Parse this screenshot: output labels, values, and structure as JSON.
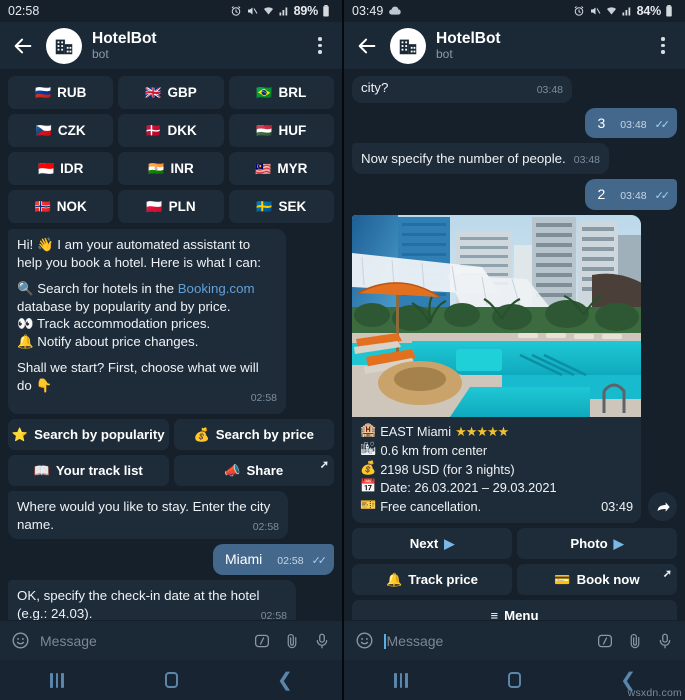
{
  "left": {
    "statusbar": {
      "time": "02:58",
      "battery": "89%",
      "icons": [
        "alarm-icon",
        "mute-icon",
        "wifi-icon",
        "signal-icon",
        "battery-icon"
      ]
    },
    "header": {
      "title": "HotelBot",
      "subtitle": "bot",
      "back_icon": "back-arrow-icon",
      "avatar_icon": "building-icon",
      "menu_icon": "kebab-menu-icon"
    },
    "currency_keyboard": [
      {
        "flag": "🇷🇺",
        "code": "RUB"
      },
      {
        "flag": "🇬🇧",
        "code": "GBP"
      },
      {
        "flag": "🇧🇷",
        "code": "BRL"
      },
      {
        "flag": "🇨🇿",
        "code": "CZK"
      },
      {
        "flag": "🇩🇰",
        "code": "DKK"
      },
      {
        "flag": "🇭🇺",
        "code": "HUF"
      },
      {
        "flag": "🇮🇩",
        "code": "IDR"
      },
      {
        "flag": "🇮🇳",
        "code": "INR"
      },
      {
        "flag": "🇲🇾",
        "code": "MYR"
      },
      {
        "flag": "🇳🇴",
        "code": "NOK"
      },
      {
        "flag": "🇵🇱",
        "code": "PLN"
      },
      {
        "flag": "🇸🇪",
        "code": "SEK"
      }
    ],
    "welcome": {
      "line1": "Hi! 👋 I am your automated assistant to help you book a hotel. Here is what I can:",
      "line2_pre": "🔍 Search for hotels in the ",
      "line2_link": "Booking.com",
      "line2_post": " database by popularity and by price.",
      "line3": "👀 Track accommodation prices.",
      "line4": "🔔 Notify about price changes.",
      "line5": "Shall we start? First, choose what we will do 👇",
      "time": "02:58"
    },
    "action_buttons": [
      {
        "emoji": "⭐",
        "label": "Search by popularity"
      },
      {
        "emoji": "💰",
        "label": "Search by price"
      },
      {
        "emoji": "📖",
        "label": "Your track list"
      },
      {
        "emoji": "📣",
        "label": "Share",
        "corner": "share-arrow-icon"
      }
    ],
    "messages": [
      {
        "from": "bot",
        "text": "Where would you like to stay. Enter the city name.",
        "time": "02:58"
      },
      {
        "from": "user",
        "text": "Miami",
        "time": "02:58",
        "status": "read"
      },
      {
        "from": "bot",
        "text": "OK, specify the check-in date at the hotel (e.g.: 24.03).",
        "time": "02:58"
      }
    ],
    "input": {
      "placeholder": "Message",
      "emoji_icon": "smiley-icon",
      "command_icon": "slash-command-icon",
      "attach_icon": "paperclip-icon",
      "voice_icon": "microphone-icon"
    },
    "nav": {
      "recent_icon": "recent-apps-icon",
      "home_icon": "home-icon",
      "back_icon": "back-icon"
    }
  },
  "right": {
    "statusbar": {
      "time": "03:49",
      "battery": "84%",
      "icons": [
        "cloud-icon",
        "alarm-icon",
        "mute-icon",
        "wifi-icon",
        "signal-icon",
        "battery-icon"
      ]
    },
    "header": {
      "title": "HotelBot",
      "subtitle": "bot",
      "back_icon": "back-arrow-icon",
      "avatar_icon": "building-icon",
      "menu_icon": "kebab-menu-icon"
    },
    "messages": [
      {
        "from": "bot",
        "text": "city?",
        "time": "03:48"
      },
      {
        "from": "user",
        "text": "3",
        "time": "03:48",
        "status": "read"
      },
      {
        "from": "bot",
        "text": "Now specify the number of people.",
        "time": "03:48"
      },
      {
        "from": "user",
        "text": "2",
        "time": "03:48",
        "status": "read"
      }
    ],
    "hotel_card": {
      "photo_alt": "hotel-pool-photo",
      "name_emoji": "🏨",
      "name": "EAST Miami",
      "stars": "★★★★★",
      "distance_emoji": "🏙",
      "distance": "0.6 km from center",
      "price_emoji": "💰",
      "price": "2198 USD (for 3 nights)",
      "date_emoji": "📅",
      "date": "Date: 26.03.2021 – 29.03.2021",
      "cancel_emoji": "🎫",
      "cancellation": "Free cancellation.",
      "time": "03:49",
      "forward_icon": "forward-arrow-icon"
    },
    "action_buttons": [
      {
        "label": "Next",
        "trailing": "▶"
      },
      {
        "label": "Photo",
        "trailing": "▶"
      },
      {
        "emoji": "🔔",
        "label": "Track price"
      },
      {
        "emoji": "💳",
        "label": "Book now",
        "corner": "external-link-icon"
      },
      {
        "emoji": "≡",
        "label": "Menu"
      }
    ],
    "input": {
      "placeholder": "Message",
      "emoji_icon": "smiley-icon",
      "command_icon": "slash-command-icon",
      "attach_icon": "paperclip-icon",
      "voice_icon": "microphone-icon"
    },
    "nav": {
      "recent_icon": "recent-apps-icon",
      "home_icon": "home-icon",
      "back_icon": "back-icon"
    },
    "watermark": "wsxdn.com"
  }
}
